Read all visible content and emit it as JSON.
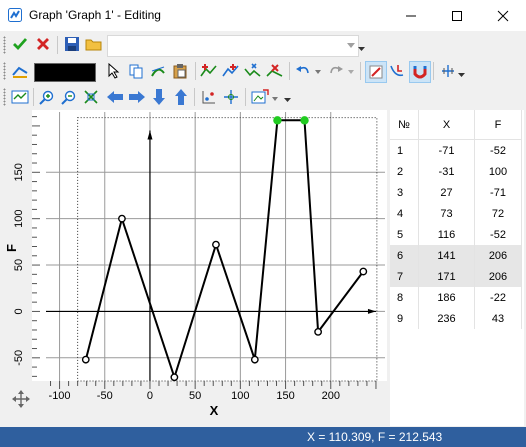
{
  "window": {
    "title": "Graph 'Graph 1' - Editing"
  },
  "toolbar1": {
    "accept_icon": "check-icon",
    "cancel_icon": "close-icon",
    "save_icon": "save-icon",
    "open_icon": "folder-icon",
    "combo_value": ""
  },
  "toolbar2": {
    "color_value": "#000000"
  },
  "graph": {
    "y_axis_label": "F",
    "x_axis_label": "X",
    "y_ticks": [
      "-50",
      "0",
      "50",
      "100",
      "150"
    ],
    "x_ticks": [
      "-100",
      "-50",
      "0",
      "50",
      "100",
      "150",
      "200"
    ]
  },
  "table": {
    "headers": [
      "№",
      "X",
      "F"
    ],
    "rows": [
      {
        "n": "1",
        "x": "-71",
        "f": "-52"
      },
      {
        "n": "2",
        "x": "-31",
        "f": "100"
      },
      {
        "n": "3",
        "x": "27",
        "f": "-71"
      },
      {
        "n": "4",
        "x": "73",
        "f": "72"
      },
      {
        "n": "5",
        "x": "116",
        "f": "-52"
      },
      {
        "n": "6",
        "x": "141",
        "f": "206"
      },
      {
        "n": "7",
        "x": "171",
        "f": "206"
      },
      {
        "n": "8",
        "x": "186",
        "f": "-22"
      },
      {
        "n": "9",
        "x": "236",
        "f": "43"
      }
    ],
    "selected_rows": [
      6,
      7
    ]
  },
  "chart_data": {
    "type": "line",
    "title": "",
    "xlabel": "X",
    "ylabel": "F",
    "xlim": [
      -115,
      260
    ],
    "ylim": [
      -75,
      215
    ],
    "x_ticks": [
      -100,
      -50,
      0,
      50,
      100,
      150,
      200
    ],
    "y_ticks": [
      -50,
      0,
      50,
      100,
      150
    ],
    "grid": true,
    "series": [
      {
        "x": [
          -71,
          -31,
          27,
          73,
          116,
          141,
          171,
          186,
          236
        ],
        "y": [
          -52,
          100,
          -71,
          72,
          -52,
          206,
          206,
          -22,
          43
        ]
      }
    ],
    "selected_points": [
      6,
      7
    ]
  },
  "status": {
    "text": "X = 110.309, F = 212.543"
  }
}
